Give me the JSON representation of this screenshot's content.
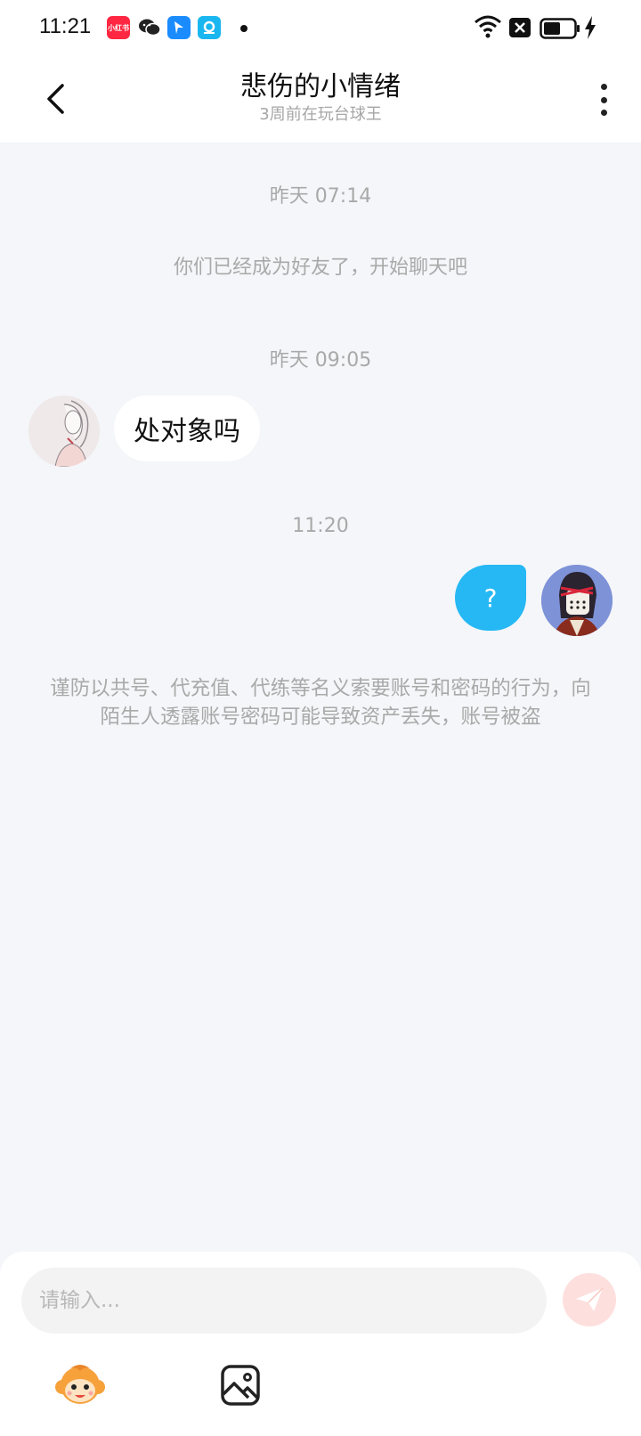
{
  "status_bar": {
    "time": "11:21",
    "apps": [
      {
        "name": "xiaohongshu-icon",
        "label": "小红书",
        "color": "#ff2741"
      },
      {
        "name": "wechat-icon",
        "color": "#222222"
      },
      {
        "name": "app-blue-icon",
        "color": "#1a8cff"
      },
      {
        "name": "app-cyan-icon",
        "color": "#1ab6f0"
      }
    ],
    "icons": [
      "wifi-icon",
      "close-icon",
      "battery-icon",
      "charging-icon"
    ]
  },
  "header": {
    "title": "悲伤的小情绪",
    "subtitle": "3周前在玩台球王"
  },
  "messages": {
    "ts1": "昨天 07:14",
    "friend_notice": "你们已经成为好友了，开始聊天吧",
    "ts2": "昨天 09:05",
    "incoming_text": "处对象吗",
    "ts3": "11:20",
    "outgoing_text": "?",
    "warning": "谨防以共号、代充值、代练等名义索要账号和密码的行为，向陌生人透露账号密码可能导致资产丢失，账号被盗"
  },
  "input": {
    "placeholder": "请输入..."
  },
  "colors": {
    "accent_blue": "#25b8f4",
    "send_button": "#fde0de",
    "send_icon": "#ffb3ab",
    "background": "#f4f6f9"
  }
}
